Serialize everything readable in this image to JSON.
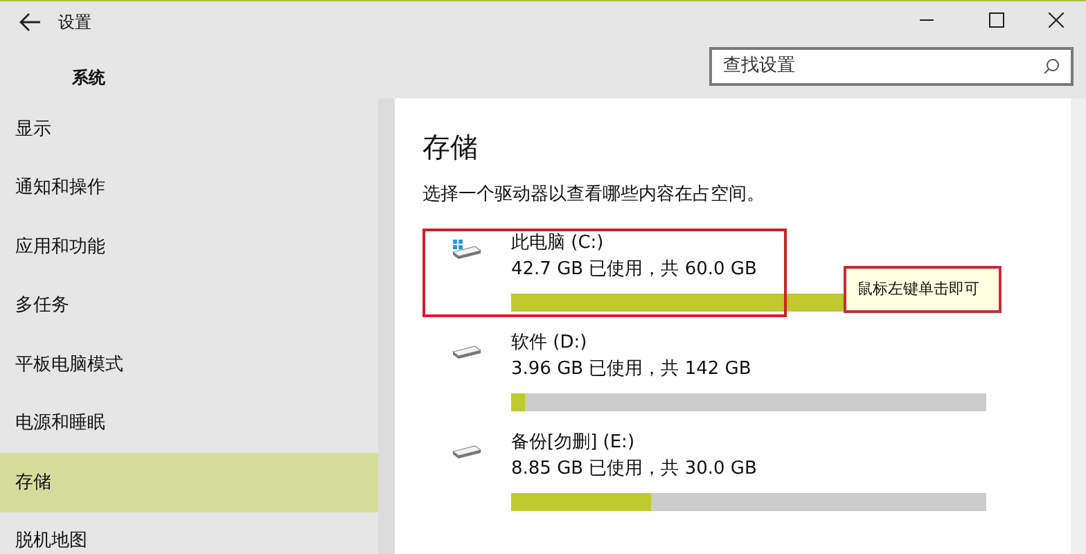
{
  "window": {
    "title": "设置",
    "section": "系统"
  },
  "search": {
    "placeholder": "查找设置"
  },
  "sidebar": {
    "items": [
      {
        "label": "显示",
        "selected": false
      },
      {
        "label": "通知和操作",
        "selected": false
      },
      {
        "label": "应用和功能",
        "selected": false
      },
      {
        "label": "多任务",
        "selected": false
      },
      {
        "label": "平板电脑模式",
        "selected": false
      },
      {
        "label": "电源和睡眠",
        "selected": false
      },
      {
        "label": "存储",
        "selected": true
      },
      {
        "label": "脱机地图",
        "selected": false
      }
    ]
  },
  "page": {
    "heading": "存储",
    "description": "选择一个驱动器以查看哪些内容在占空间。"
  },
  "drives": [
    {
      "kind": "system",
      "name": "此电脑 (C:)",
      "usage": "42.7 GB 已使用，共 60.0 GB",
      "level": 0.71,
      "highlighted": true
    },
    {
      "kind": "data",
      "name": "软件 (D:)",
      "usage": "3.96 GB 已使用，共 142 GB",
      "level": 0.028,
      "highlighted": false
    },
    {
      "kind": "data",
      "name": "备份[勿删] (E:)",
      "usage": "8.85 GB 已使用，共 30.0 GB",
      "level": 0.295,
      "highlighted": false
    }
  ],
  "callout": {
    "text": "鼠标左键单击即可"
  }
}
